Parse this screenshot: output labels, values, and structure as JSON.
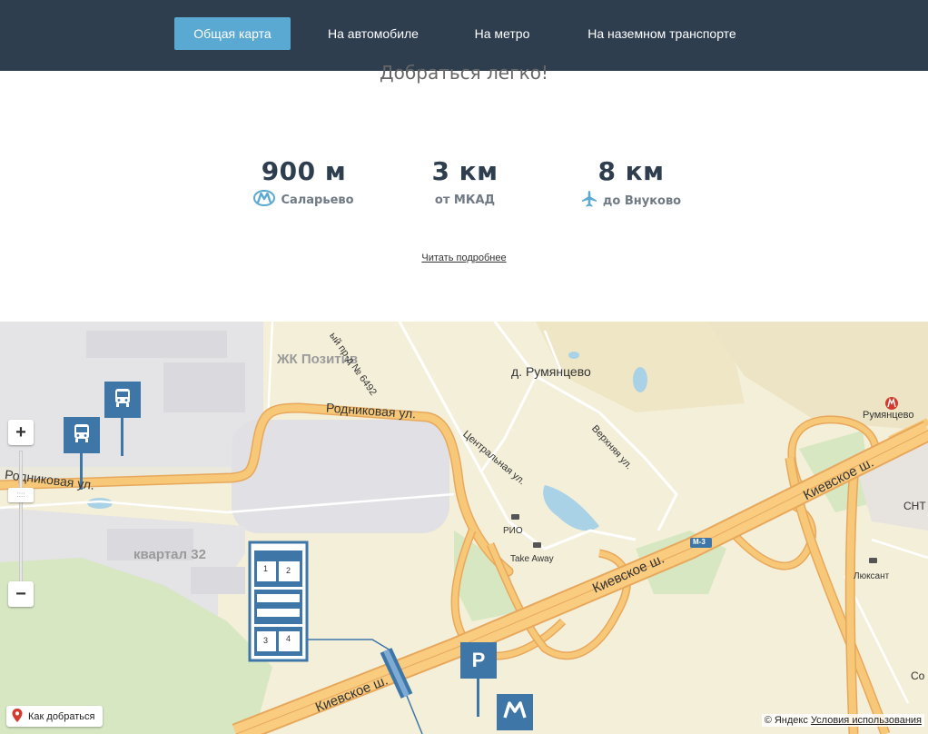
{
  "nav": {
    "tabs": [
      {
        "label": "Общая карта",
        "active": true
      },
      {
        "label": "На автомобиле",
        "active": false
      },
      {
        "label": "На метро",
        "active": false
      },
      {
        "label": "На наземном транспорте",
        "active": false
      }
    ]
  },
  "headline": "Добраться легко!",
  "stats": [
    {
      "value": "900 м",
      "caption": "Саларьево",
      "icon": "metro-icon"
    },
    {
      "value": "3 км",
      "caption": "от МКАД",
      "icon": ""
    },
    {
      "value": "8 км",
      "caption": "до Внуково",
      "icon": "airplane-icon"
    }
  ],
  "more_link": "Читать подробнее",
  "map": {
    "labels": {
      "zhk_pozitiv": "ЖК Позитив",
      "rumyantsevo_village": "д. Румянцево",
      "rumyantsevo_metro": "Румянцево",
      "rodnikovaya_1": "Родниковая ул.",
      "rodnikovaya_2": "Родниковая ул.",
      "tsentralnaya": "Центральная ул.",
      "verkhnyaya": "Верхняя ул.",
      "pr_6492": "ый пр-д № 6492",
      "kvartal": "квартал 32",
      "kievskoe_1": "Киевское ш.",
      "kievskoe_2": "Киевское ш.",
      "kievskoe_3": "Киевское ш.",
      "m3": "М-3",
      "rio": "РИО",
      "takeaway": "Take Away",
      "lyuksant": "Люксант",
      "snt": "СНТ",
      "sod": "Со"
    },
    "plan_numbers": [
      "1",
      "2",
      "3",
      "4"
    ],
    "parking_letter": "P",
    "metro_letter": "M",
    "route_button": "Как добраться",
    "copyright": "© Яндекс",
    "terms_link": "Условия использования",
    "colors": {
      "nav_bg": "#2e3e4f",
      "tab_active": "#5aa9d3",
      "marker": "#3e76a8",
      "road": "#f2b968",
      "water": "#a9d2e6",
      "green": "#d6e7c2",
      "metro_red": "#d23b2e"
    }
  }
}
